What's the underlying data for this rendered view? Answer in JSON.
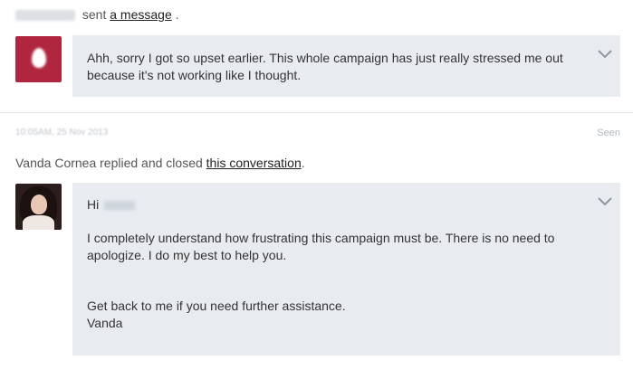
{
  "message1": {
    "sender_name": "Eve Herald",
    "action_text": "sent",
    "link_text": "a message",
    "trailing": ".",
    "body": "Ahh, sorry I got so upset earlier. This whole campaign has just really stressed me out because it's not working like I thought."
  },
  "meta": {
    "timestamp": "10:05AM, 25 Nov 2013",
    "seen_label": "Seen"
  },
  "message2": {
    "agent_name": "Vanda Cornea",
    "action_text": "replied and closed",
    "link_text": "this conversation",
    "trailing": ".",
    "greeting": "Hi",
    "recipient_name": "Libby",
    "paragraph1": "I completely understand how frustrating this campaign must be. There is no need to apologize. I do my best to help you.",
    "closing_line": "Get back to me if you need further assistance.",
    "signature": "Vanda"
  },
  "icons": {
    "avatar_user": "egg-avatar-icon",
    "chevron": "chevron-down-icon"
  },
  "colors": {
    "bubble_bg": "#e8ecf1",
    "avatar_user_bg": "#b1263f"
  }
}
